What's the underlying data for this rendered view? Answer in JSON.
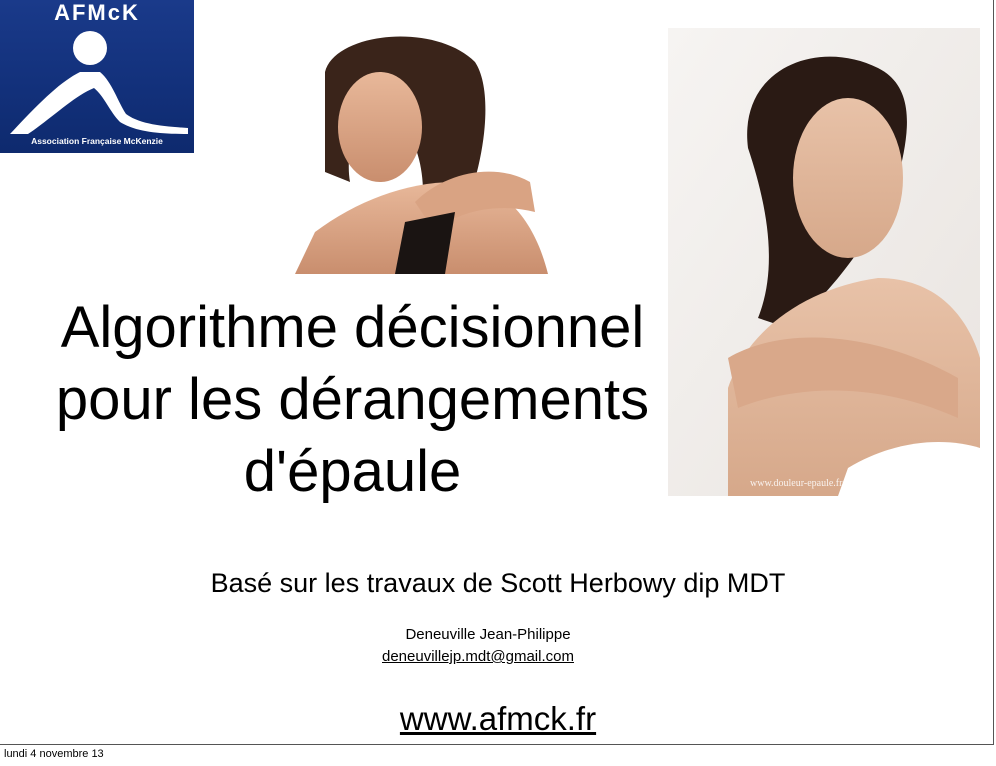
{
  "logo": {
    "title": "AFMcK",
    "subtitle": "Association Française McKenzie"
  },
  "photos": {
    "left_alt": "woman-holding-shoulder",
    "right_alt": "woman-holding-shoulder-2",
    "watermark": "www.douleur-epaule.fr"
  },
  "title": {
    "line1": "Algorithme décisionnel",
    "line2": "pour les dérangements",
    "line3": "d'épaule"
  },
  "subtitle": "Basé sur les travaux de Scott Herbowy dip MDT",
  "author": "Deneuville Jean-Philippe",
  "email": "deneuvillejp.mdt@gmail.com",
  "website": "www.afmck.fr",
  "footer": "lundi 4 novembre 13",
  "colors": {
    "logo_bg": "#12307a",
    "text": "#000000"
  }
}
